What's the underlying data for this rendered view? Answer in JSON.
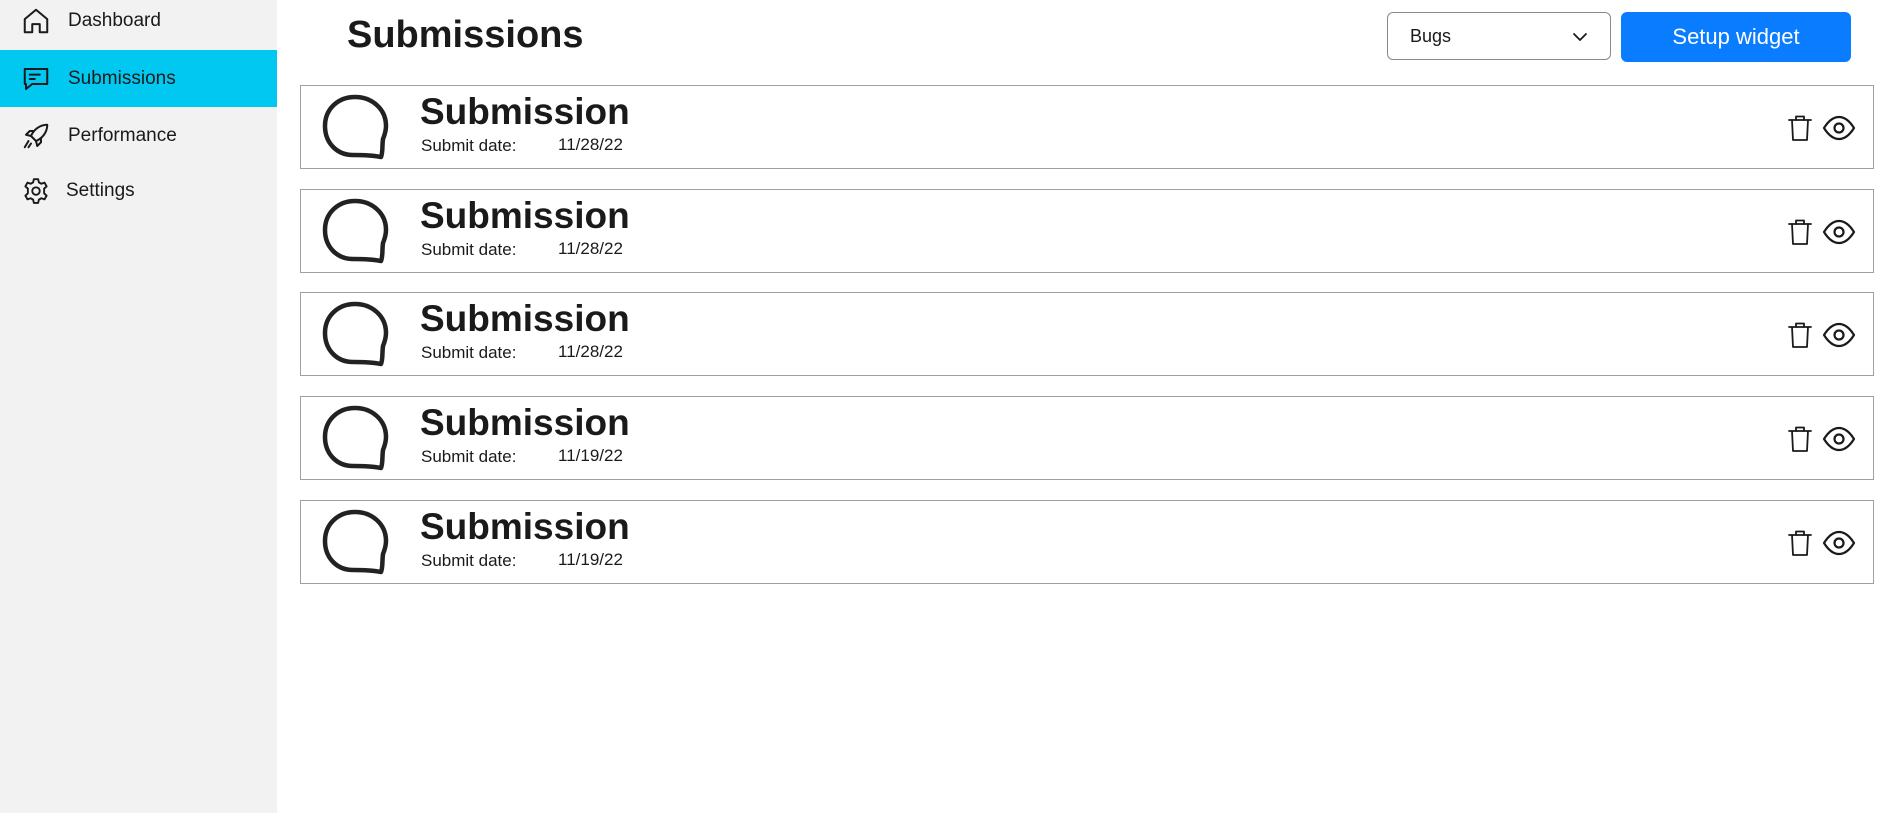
{
  "sidebar": {
    "items": [
      {
        "label": "Dashboard",
        "icon": "home-icon",
        "active": false
      },
      {
        "label": "Submissions",
        "icon": "message-square-icon",
        "active": true
      },
      {
        "label": "Performance",
        "icon": "rocket-icon",
        "active": false
      },
      {
        "label": "Settings",
        "icon": "gear-icon",
        "active": false
      }
    ],
    "active_color": "#00c8f0",
    "background": "#f2f2f2"
  },
  "header": {
    "title": "Submissions",
    "filter": {
      "selected": "Bugs"
    },
    "setup_button_label": "Setup widget",
    "setup_button_color": "#0a7cff"
  },
  "submissions": [
    {
      "title": "Submission",
      "date_label": "Submit date:",
      "date": "11/28/22"
    },
    {
      "title": "Submission",
      "date_label": "Submit date:",
      "date": "11/28/22"
    },
    {
      "title": "Submission",
      "date_label": "Submit date:",
      "date": "11/28/22"
    },
    {
      "title": "Submission",
      "date_label": "Submit date:",
      "date": "11/19/22"
    },
    {
      "title": "Submission",
      "date_label": "Submit date:",
      "date": "11/19/22"
    }
  ]
}
